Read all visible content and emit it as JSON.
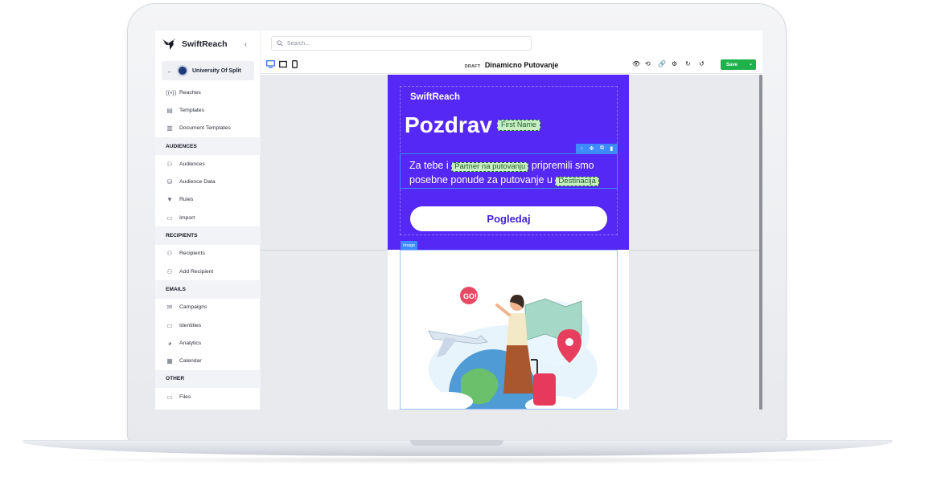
{
  "app": {
    "brand": "SwiftReach",
    "collapse_icon": "chevron-left-icon"
  },
  "org_switcher": {
    "name": "University Of Split"
  },
  "search": {
    "placeholder": "Search..."
  },
  "sidebar": {
    "top_items": [
      {
        "label": "Reaches",
        "icon": "broadcast-icon"
      },
      {
        "label": "Templates",
        "icon": "templates-icon"
      },
      {
        "label": "Document Templates",
        "icon": "document-icon"
      }
    ],
    "sections": [
      {
        "title": "AUDIENCES",
        "items": [
          {
            "label": "Audiences",
            "icon": "users-icon"
          },
          {
            "label": "Audience Data",
            "icon": "database-icon"
          },
          {
            "label": "Rules",
            "icon": "filter-icon"
          },
          {
            "label": "Import",
            "icon": "folder-icon"
          }
        ]
      },
      {
        "title": "RECIPIENTS",
        "items": [
          {
            "label": "Recipients",
            "icon": "recipient-icon"
          },
          {
            "label": "Add Recipient",
            "icon": "add-user-icon"
          }
        ]
      },
      {
        "title": "EMAILS",
        "items": [
          {
            "label": "Campaigns",
            "icon": "mail-icon"
          },
          {
            "label": "Identities",
            "icon": "id-card-icon"
          },
          {
            "label": "Analytics",
            "icon": "pie-chart-icon"
          },
          {
            "label": "Calendar",
            "icon": "calendar-icon"
          }
        ]
      },
      {
        "title": "OTHER",
        "items": [
          {
            "label": "Files",
            "icon": "folder-icon"
          }
        ]
      }
    ]
  },
  "editor": {
    "status": "DRAFT",
    "document_title": "Dinamicno Putovanje",
    "save_label": "Save",
    "devices": [
      "desktop-icon",
      "tablet-icon",
      "mobile-icon"
    ],
    "tools": [
      "preview-icon",
      "history-icon",
      "link-icon",
      "settings-icon",
      "redo-icon",
      "undo-icon"
    ]
  },
  "email": {
    "brand": "SwiftReach",
    "greeting": "Pozdrav",
    "greeting_tag": "First Name",
    "body_part1": "Za tebe i",
    "tag_partner": "Partner na putovanju",
    "body_part2": "pripremili smo posebne ponude za putovanje u",
    "tag_destination": "Destinacija",
    "cta": "Pogledaj",
    "image_label": "Image",
    "block_tools": [
      "move-up-icon",
      "drag-icon",
      "duplicate-icon",
      "delete-icon"
    ]
  },
  "colors": {
    "hero_bg": "#5528f5",
    "save_bg": "#1fb24a",
    "selection": "#3d8bff",
    "tag_bg": "#c9f0c4"
  }
}
